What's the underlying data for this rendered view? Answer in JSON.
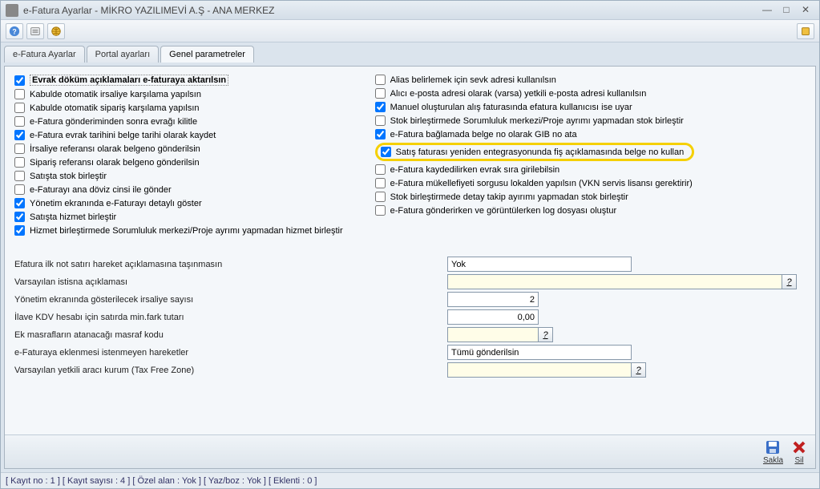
{
  "window": {
    "title": "e-Fatura Ayarlar - MİKRO YAZILIMEVİ A.Ş  - ANA MERKEZ"
  },
  "tabs": {
    "t1": "e-Fatura Ayarlar",
    "t2": "Portal ayarları",
    "t3": "Genel parametreler"
  },
  "checks": {
    "l1": "Evrak döküm açıklamaları e-faturaya aktarılsın",
    "l2": "Kabulde otomatik irsaliye karşılama yapılsın",
    "l3": "Kabulde otomatik sipariş karşılama yapılsın",
    "l4": "e-Fatura gönderiminden sonra evrağı kilitle",
    "l5": "e-Fatura evrak tarihini belge tarihi olarak kaydet",
    "l6": "İrsaliye referansı olarak belgeno gönderilsin",
    "l7": "Sipariş referansı olarak belgeno gönderilsin",
    "l8": "Satışta stok birleştir",
    "l9": "e-Faturayı ana döviz cinsi ile gönder",
    "l10": "Yönetim ekranında e-Faturayı detaylı göster",
    "l11": "Satışta hizmet birleştir",
    "l12": "Hizmet birleştirmede Sorumluluk merkezi/Proje ayrımı yapmadan hizmet birleştir",
    "r1": "Alias belirlemek için sevk adresi kullanılsın",
    "r2": "Alıcı e-posta adresi olarak (varsa) yetkili e-posta adresi kullanılsın",
    "r3": "Manuel oluşturulan alış faturasında efatura kullanıcısı ise uyar",
    "r4": "Stok birleştirmede Sorumluluk merkezi/Proje ayrımı yapmadan stok birleştir",
    "r5": "e-Fatura bağlamada belge no olarak GIB no ata",
    "r6": "Satış faturası yeniden entegrasyonunda fiş açıklamasında belge no kullan",
    "r7": "e-Fatura kaydedilirken evrak sıra girilebilsin",
    "r8": "e-Fatura mükellefiyeti sorgusu lokalden yapılsın (VKN servis lisansı gerektirir)",
    "r9": "Stok birleştirmede detay takip ayırımı yapmadan stok birleştir",
    "r10": "e-Fatura gönderirken ve görüntülerken log dosyası oluştur"
  },
  "form": {
    "f1_label": "Efatura ilk not satırı hareket açıklamasına taşınmasın",
    "f1_value": "Yok",
    "f2_label": "Varsayılan istisna açıklaması",
    "f2_value": "",
    "f3_label": "Yönetim ekranında gösterilecek irsaliye sayısı",
    "f3_value": "2",
    "f4_label": "İlave KDV hesabı için satırda min.fark tutarı",
    "f4_value": "0,00",
    "f5_label": "Ek masrafların atanacağı masraf kodu",
    "f5_value": "",
    "f6_label": "e-Faturaya eklenmesi istenmeyen hareketler",
    "f6_value": "Tümü gönderilsin",
    "f7_label": "Varsayılan yetkili aracı kurum (Tax Free Zone)",
    "f7_value": "",
    "qmark": "?"
  },
  "footer": {
    "save": "Sakla",
    "delete": "Sil"
  },
  "status": {
    "text": "[ Kayıt no : 1 ] [ Kayıt sayısı : 4 ] [ Özel alan : Yok ] [ Yaz/boz : Yok ] [ Eklenti : 0 ]"
  }
}
